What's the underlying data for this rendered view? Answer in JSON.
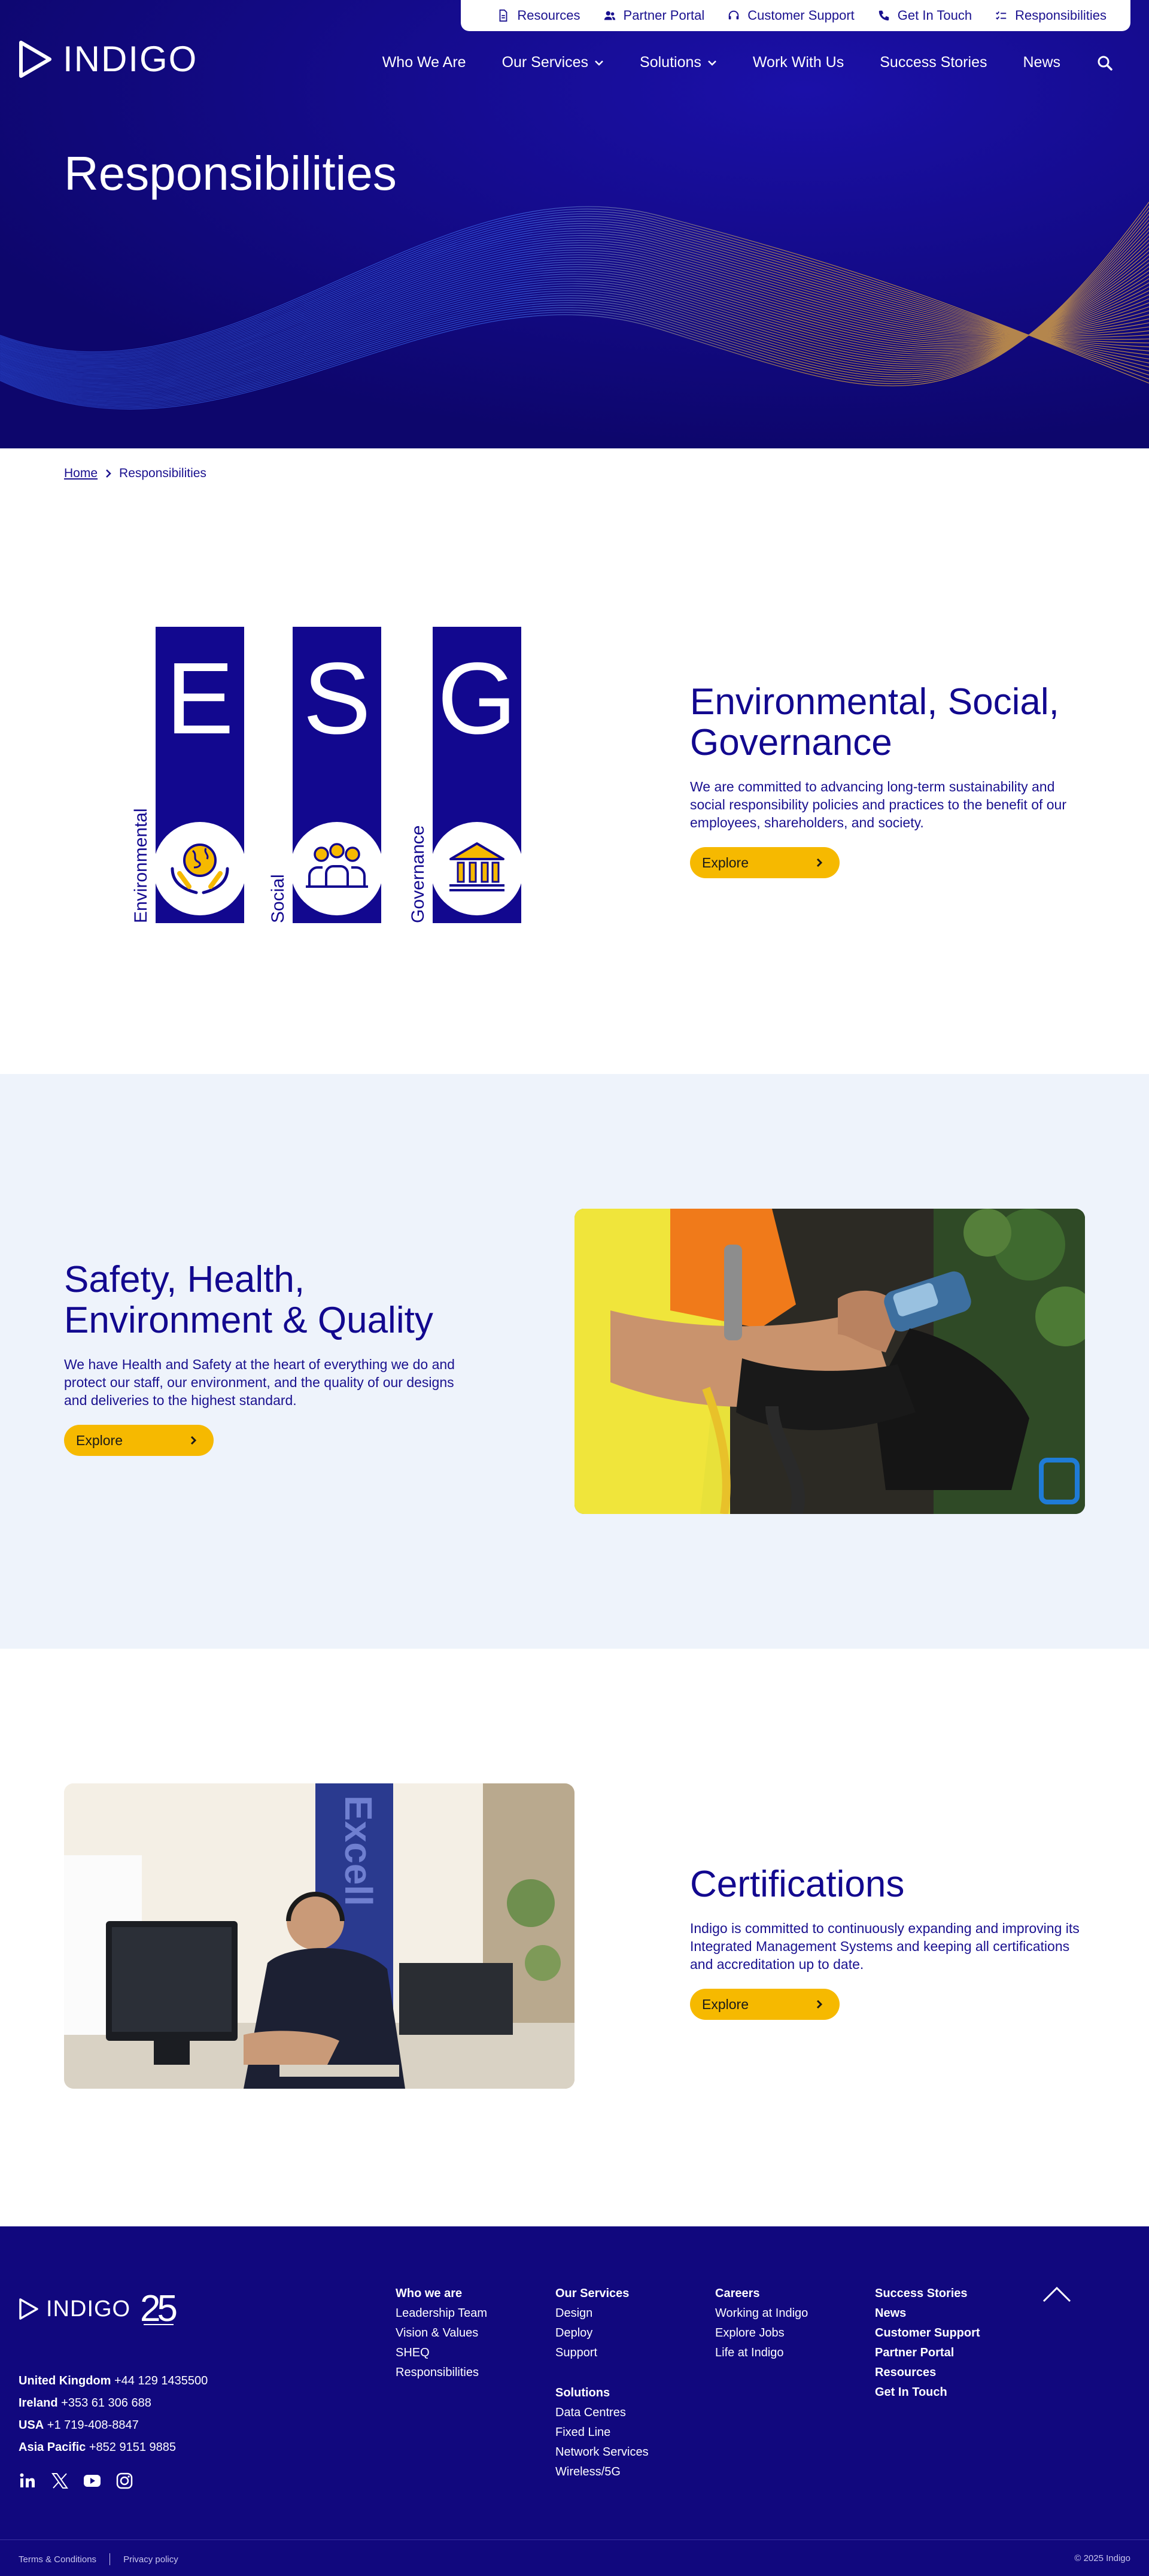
{
  "brand": {
    "name": "INDIGO",
    "accent": "#11087e",
    "button": "#f6b900",
    "light_bg": "#eef3fb"
  },
  "utility_nav": [
    {
      "label": "Resources",
      "icon": "document-icon"
    },
    {
      "label": "Partner Portal",
      "icon": "users-icon"
    },
    {
      "label": "Customer Support",
      "icon": "headset-icon"
    },
    {
      "label": "Get In Touch",
      "icon": "phone-icon"
    },
    {
      "label": "Responsibilities",
      "icon": "checklist-icon"
    }
  ],
  "main_nav": [
    {
      "label": "Who We Are",
      "dropdown": false
    },
    {
      "label": "Our Services",
      "dropdown": true
    },
    {
      "label": "Solutions",
      "dropdown": true
    },
    {
      "label": "Work With Us",
      "dropdown": false
    },
    {
      "label": "Success Stories",
      "dropdown": false
    },
    {
      "label": "News",
      "dropdown": false
    }
  ],
  "hero": {
    "title": "Responsibilities"
  },
  "breadcrumb": {
    "home": "Home",
    "current": "Responsibilities"
  },
  "esg": {
    "title": "Environmental, Social, Governance",
    "text": "We are committed to advancing long-term sustainability and social responsibility policies and practices to the benefit of our employees, shareholders, and society.",
    "button": "Explore",
    "pillars": [
      {
        "letter": "E",
        "label": "Environmental",
        "icon": "globe-hands-icon"
      },
      {
        "letter": "S",
        "label": "Social",
        "icon": "people-icon"
      },
      {
        "letter": "G",
        "label": "Governance",
        "icon": "institution-icon"
      }
    ]
  },
  "sheq": {
    "title": "Safety, Health, Environment & Quality",
    "text": "We have Health and Safety at the heart of everything we do and protect our staff, our environment, and the quality of our designs and deliveries to the highest standard.",
    "button": "Explore"
  },
  "cert": {
    "title": "Certifications",
    "text": "Indigo is committed to continuously expanding and improving its Integrated Management Systems and keeping all certifications and accreditation up to date.",
    "button": "Explore",
    "photo_text": "Excell"
  },
  "footer": {
    "logo_text": "INDIGO",
    "anniversary_number": "25",
    "contacts": [
      {
        "region": "United Kingdom",
        "phone": "+44 129 1435500"
      },
      {
        "region": "Ireland",
        "phone": "+353 61 306 688"
      },
      {
        "region": "USA",
        "phone": "+1 719-408-8847"
      },
      {
        "region": "Asia Pacific",
        "phone": "+852 9151 9885"
      }
    ],
    "social": [
      "linkedin-icon",
      "x-icon",
      "youtube-icon",
      "instagram-icon"
    ],
    "col_who": {
      "head": "Who we are",
      "items": [
        "Leadership Team",
        "Vision & Values",
        "SHEQ",
        "Responsibilities"
      ]
    },
    "col_services": {
      "head": "Our Services",
      "items": [
        "Design",
        "Deploy",
        "Support"
      ],
      "head2": "Solutions",
      "items2": [
        "Data Centres",
        "Fixed Line",
        "Network Services",
        "Wireless/5G"
      ]
    },
    "col_careers": {
      "head": "Careers",
      "items": [
        "Working at Indigo",
        "Explore Jobs",
        "Life at Indigo"
      ]
    },
    "col_links": [
      "Success Stories",
      "News",
      "Customer Support",
      "Partner Portal",
      "Resources",
      "Get In Touch"
    ],
    "legal": [
      "Terms & Conditions",
      "Privacy policy"
    ],
    "copyright": "© 2025 Indigo"
  }
}
